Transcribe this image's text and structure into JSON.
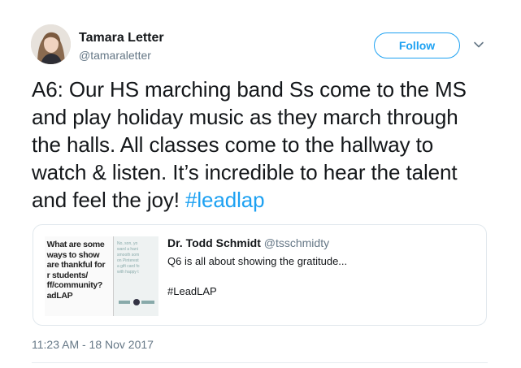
{
  "author": {
    "display_name": "Tamara Letter",
    "handle": "@tamaraletter",
    "avatar_icon": "profile-photo"
  },
  "actions": {
    "follow_label": "Follow",
    "menu_icon": "chevron-down-icon"
  },
  "tweet": {
    "text": "A6: Our HS marching band Ss come to the MS and play holiday music as they march through the halls. All classes come to the hallway to watch & listen. It’s incredible to hear the talent and feel the joy! ",
    "hashtag": "#leadlap",
    "timestamp": "11:23 AM - 18 Nov 2017"
  },
  "quoted_tweet": {
    "author_name": "Dr. Todd Schmidt",
    "author_handle": "@tsschmidty",
    "line1": "Q6 is all about showing the gratitude...",
    "line2": "#LeadLAP",
    "thumbnail_text": " What are some\n ways to show\n are thankful for\n r students/\n ff/community?\n adLAP",
    "thumbnail_side_text": "No, son, yo\nward a hani\nsmooth som\non Pinterest\na gift card fo\nwith happy t"
  },
  "colors": {
    "accent": "#1da1f2",
    "text": "#14171a",
    "muted": "#657786",
    "border": "#e1e8ed"
  }
}
